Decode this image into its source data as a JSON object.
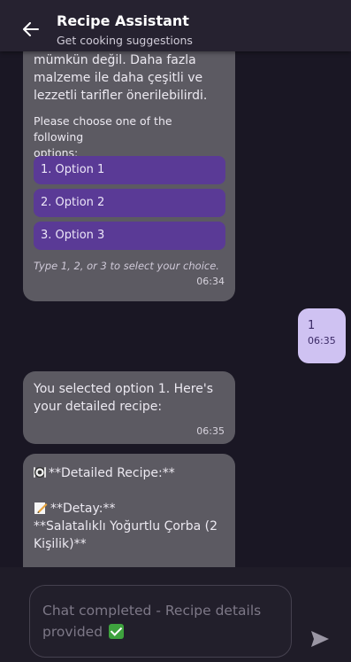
{
  "header": {
    "title": "Recipe Assistant",
    "subtitle": "Get cooking suggestions"
  },
  "messages": {
    "bot1": {
      "partial_top": "mümkün değil. Daha fazla",
      "line_a": "malzeme ile daha çeşitli ve",
      "line_b": "lezzetli tarifler önerilebilirdi.",
      "prompt_a": "Please choose one of the following",
      "prompt_b": "options:",
      "options": [
        "1. Option 1",
        "2. Option 2",
        "3. Option 3"
      ],
      "hint": "Type 1, 2, or 3 to select your choice.",
      "time": "06:34"
    },
    "user1": {
      "text": "1",
      "time": "06:35"
    },
    "bot2": {
      "line_a": "You selected option 1. Here's",
      "line_b": "your detailed recipe:",
      "time": "06:35"
    },
    "bot3": {
      "heading": "**Detailed Recipe:**",
      "detail_label": "**Detay:**",
      "dish_a": "**Salatalıklı Yoğurtlu Çorba (2",
      "dish_b": "Kişilik)**"
    }
  },
  "input": {
    "line_a": "Chat completed - Recipe details",
    "line_b": "provided"
  },
  "icons": {
    "back": "arrow-left-icon",
    "plate": "fork-knife-plate-icon",
    "memo": "memo-pencil-icon",
    "check": "check-mark-button-icon",
    "send": "send-icon"
  },
  "colors": {
    "appbar": "#262230",
    "bot_bubble": "#5c5a62",
    "user_bubble": "#cfc2f2",
    "option": "#5a3a96"
  }
}
